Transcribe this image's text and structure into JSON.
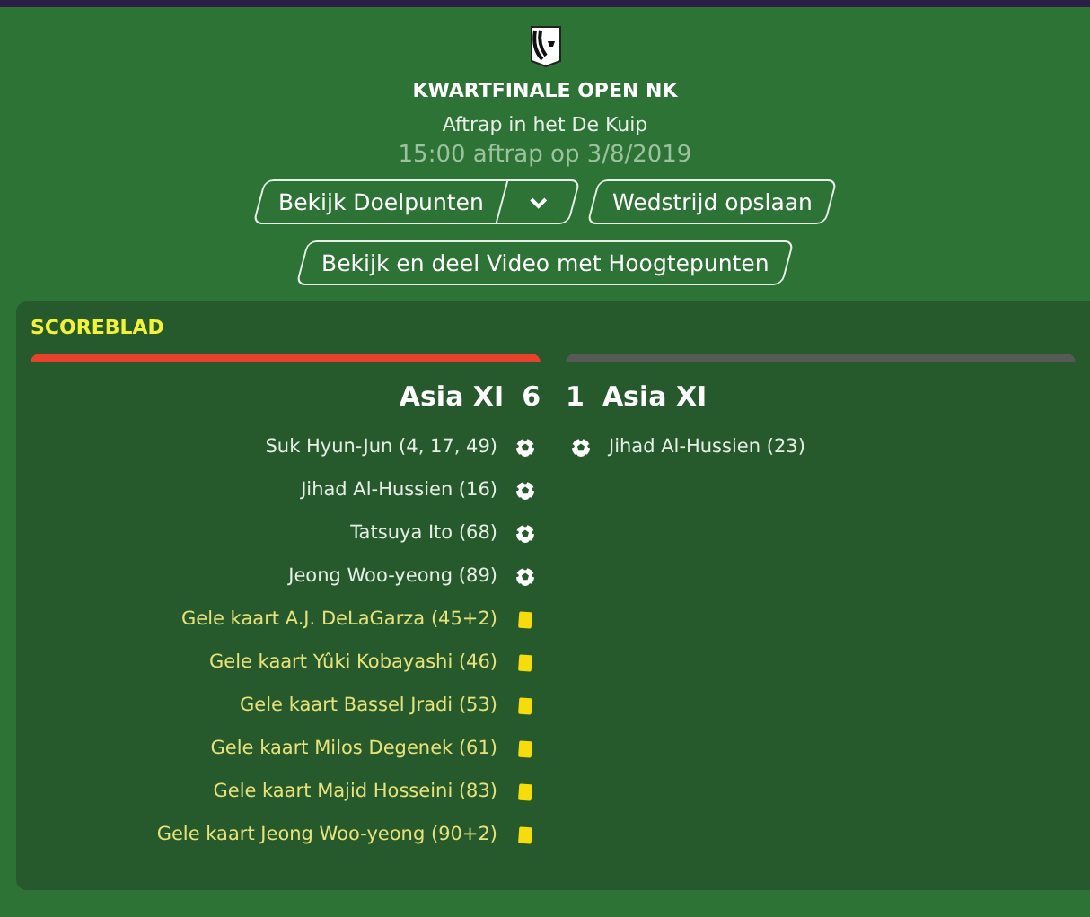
{
  "header": {
    "title": "KWARTFINALE OPEN NK",
    "venue": "Aftrap in het De Kuip",
    "kickoff": "15:00 aftrap op 3/8/2019"
  },
  "buttons": {
    "goals": "Bekijk Doelpunten",
    "save": "Wedstrijd opslaan",
    "video": "Bekijk en deel Video met Hoogtepunten"
  },
  "scoresheet": {
    "title": "SCOREBLAD",
    "home": {
      "name": "Asia XI",
      "score": "6",
      "color": "#e8412c",
      "events": [
        {
          "kind": "goal",
          "text": "Suk Hyun-Jun (4, 17, 49)"
        },
        {
          "kind": "goal",
          "text": "Jihad Al-Hussien (16)"
        },
        {
          "kind": "goal",
          "text": "Tatsuya Ito (68)"
        },
        {
          "kind": "goal",
          "text": "Jeong Woo-yeong (89)"
        },
        {
          "kind": "yellow_card",
          "text": "Gele kaart A.J. DeLaGarza (45+2)"
        },
        {
          "kind": "yellow_card",
          "text": "Gele kaart Yûki Kobayashi (46)"
        },
        {
          "kind": "yellow_card",
          "text": "Gele kaart Bassel Jradi (53)"
        },
        {
          "kind": "yellow_card",
          "text": "Gele kaart Milos Degenek (61)"
        },
        {
          "kind": "yellow_card",
          "text": "Gele kaart Majid Hosseini (83)"
        },
        {
          "kind": "yellow_card",
          "text": "Gele kaart Jeong Woo-yeong (90+2)"
        }
      ]
    },
    "away": {
      "name": "Asia XI",
      "score": "1",
      "color": "#555a57",
      "events": [
        {
          "kind": "goal",
          "text": "Jihad Al-Hussien (23)"
        }
      ]
    }
  }
}
